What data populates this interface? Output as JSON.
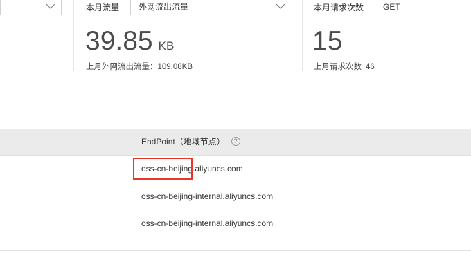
{
  "flow": {
    "label": "本月流量",
    "select_value": "外网流出流量",
    "value": "39.85",
    "unit": "KB",
    "last_month_label": "上月外网流出流量：",
    "last_month_value": "109.08KB"
  },
  "requests": {
    "label": "本月请求次数",
    "select_value": "GET",
    "value": "15",
    "last_month_label": "上月请求次数",
    "last_month_value": "46"
  },
  "endpoint_table": {
    "header": "EndPoint（地域节点）",
    "help_icon": "question-circle-icon",
    "rows": [
      "oss-cn-beijing.aliyuncs.com",
      "oss-cn-beijing-internal.aliyuncs.com",
      "oss-cn-beijing-internal.aliyuncs.com"
    ]
  },
  "colors": {
    "highlight_border": "#e8362b",
    "header_bg": "#ebebeb"
  }
}
